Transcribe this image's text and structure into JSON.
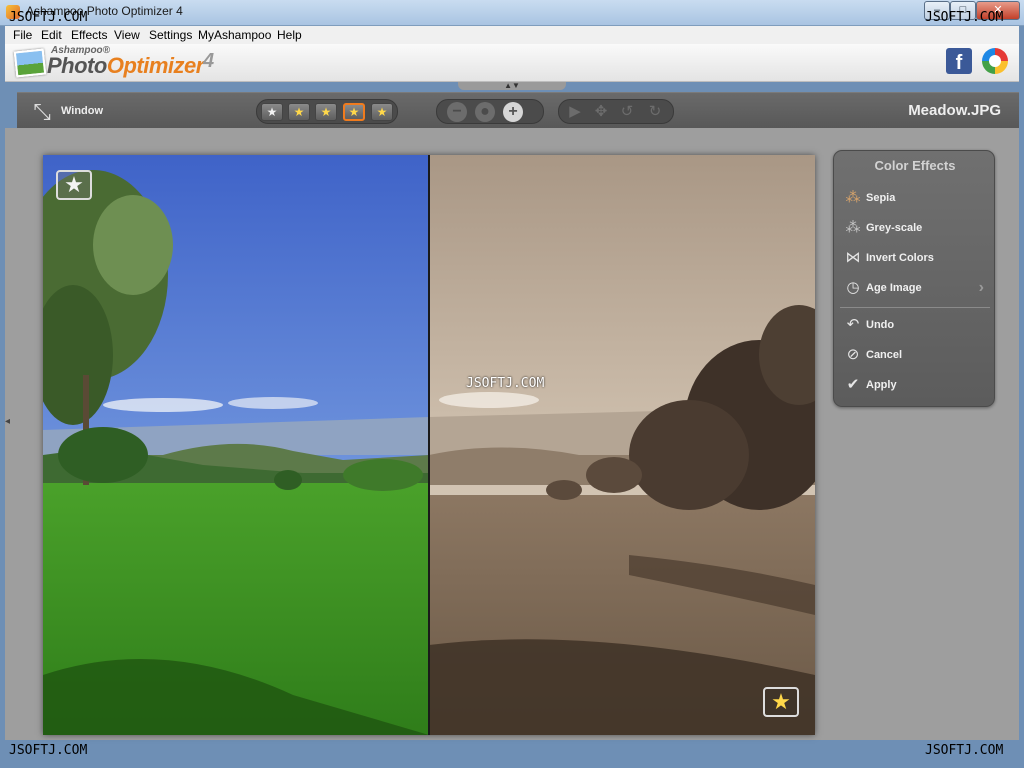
{
  "window": {
    "title": "Ashampoo Photo Optimizer 4",
    "buttons": [
      "–",
      "□",
      "✕"
    ]
  },
  "menu": [
    "File",
    "Edit",
    "Effects",
    "View",
    "Settings",
    "MyAshampoo",
    "Help"
  ],
  "brand": {
    "small": "Ashampoo®",
    "main_a": "Photo",
    "main_b": "Optimizer",
    "version": "4"
  },
  "toolbar": {
    "window_label": "Window",
    "filename": "Meadow.JPG",
    "rating_buttons": [
      "★",
      "★",
      "★",
      "★",
      "★"
    ],
    "zoom_buttons": [
      "−",
      "●",
      "+"
    ],
    "nav_buttons": [
      "▶",
      "✥",
      "↺",
      "↻"
    ]
  },
  "photo": {
    "badge_left": "★",
    "badge_right": "★"
  },
  "panel": {
    "title": "Color Effects",
    "items": [
      {
        "label": "Sepia",
        "icon": "sepia-dots-icon"
      },
      {
        "label": "Grey-scale",
        "icon": "greyscale-dots-icon"
      },
      {
        "label": "Invert Colors",
        "icon": "butterfly-icon"
      },
      {
        "label": "Age Image",
        "icon": "clock-icon"
      },
      {
        "label": "Undo",
        "icon": "undo-icon"
      },
      {
        "label": "Cancel",
        "icon": "cancel-icon"
      },
      {
        "label": "Apply",
        "icon": "checkmark-icon"
      }
    ]
  },
  "watermark": "JSOFTJ.COM",
  "colors": {
    "accent_orange": "#f07b1e",
    "toolbar_bg": "#5e5e5e",
    "panel_bg": "#666666"
  }
}
